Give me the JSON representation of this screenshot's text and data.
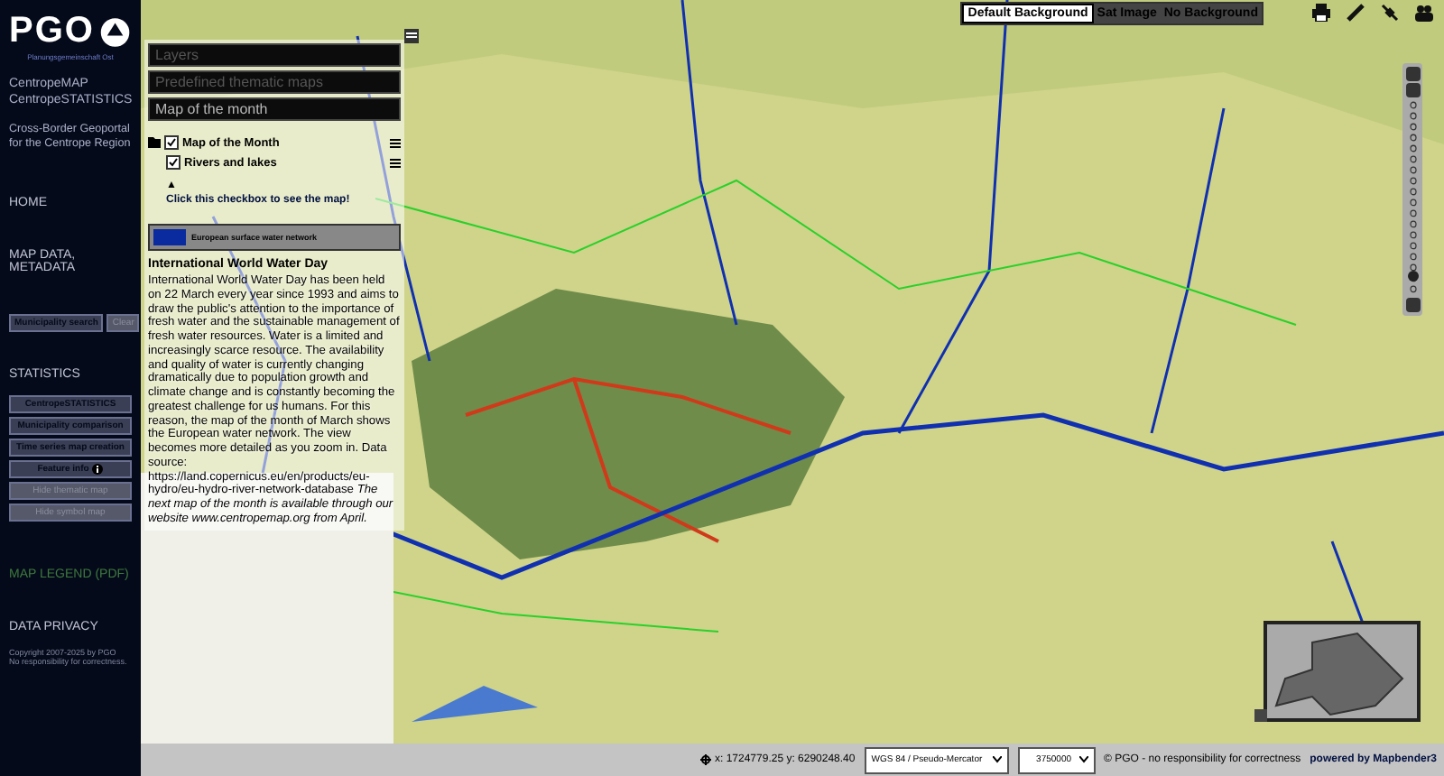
{
  "sidebar": {
    "logo": "PGO",
    "logo_subtitle": "Planungsgemeinschaft Ost",
    "apps": [
      "CentropeMAP",
      "CentropeSTATISTICS"
    ],
    "tagline": "Cross-Border Geoportal for the Centrope Region",
    "home": "HOME",
    "map_data": "MAP DATA, METADATA",
    "search_buttons": [
      {
        "label": "Municipality search",
        "disabled": false
      },
      {
        "label": "Clear",
        "disabled": true
      }
    ],
    "statistics": "STATISTICS",
    "stat_buttons": [
      {
        "label": "CentropeSTATISTICS",
        "disabled": false,
        "info": false
      },
      {
        "label": "Municipality comparison",
        "disabled": false,
        "info": false
      },
      {
        "label": "Time series map creation",
        "disabled": false,
        "info": false
      },
      {
        "label": "Feature info",
        "disabled": false,
        "info": true
      },
      {
        "label": "Hide thematic map",
        "disabled": true,
        "info": false
      },
      {
        "label": "Hide symbol map",
        "disabled": true,
        "info": false
      }
    ],
    "legend_link": {
      "label": "MAP LEGEND (PDF)",
      "disabled": true
    },
    "privacy": "DATA PRIVACY",
    "copyright": "Copyright 2007-2025 by PGO",
    "disclaimer": "No responsibility for correctness."
  },
  "panel": {
    "tabs": [
      {
        "label": "Layers",
        "selected": false
      },
      {
        "label": "Predefined thematic maps",
        "selected": false
      },
      {
        "label": "Map of the month",
        "selected": true
      }
    ],
    "tree": [
      {
        "label": "Map of the Month",
        "checked": true,
        "children": [
          {
            "label": "Rivers and lakes",
            "checked": true
          }
        ]
      }
    ],
    "arrow": "▲",
    "hint": "Click this checkbox to see the map!",
    "legend": [
      {
        "label": "European surface water network",
        "color": "#0a2aa0"
      }
    ],
    "article_title": "International World Water Day",
    "article": "International World Water Day has been held on 22 March every year since 1993 and aims to draw the public's attention to the importance of fresh water and the sustainable management of fresh water resources. Water is a limited and increasingly scarce resource. The availability and quality of water is currently changing dramatically due to population growth and climate change and is constantly becoming the greatest challenge for us humans. For this reason, the map of the month of March shows the European water network. The view becomes more detailed as you zoom in. Data source: https://land.copernicus.eu/en/products/eu-hydro/eu-hydro-river-network-database *The next map of the month is available through our website www.centropemap.org from April.*"
  },
  "backgrounds": [
    {
      "label": "Default Background",
      "selected": true
    },
    {
      "label": "Sat Image",
      "selected": false
    },
    {
      "label": "No Background",
      "selected": false
    }
  ],
  "zoom": {
    "level": 0.1
  },
  "status_bar": {
    "coordinates": "x: 1724779.25 y: 6290248.40",
    "projection": "WGS 84 / Pseudo-Mercator",
    "scale": "3750000",
    "attribution": "© PGO - no responsibility for correctness",
    "powered_by": "powered by Mapbender3"
  }
}
